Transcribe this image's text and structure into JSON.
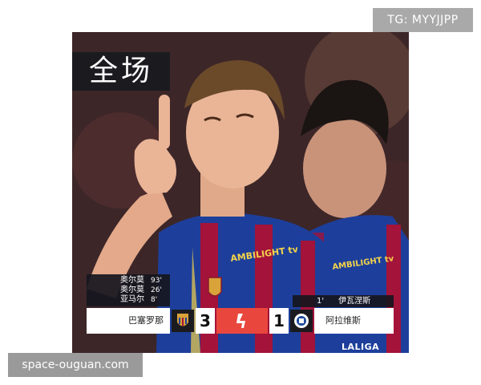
{
  "watermark_top": "TG: MYYJJPP",
  "watermark_bottom": "space-ouguan.com",
  "title": "全场",
  "match": {
    "home_team": "巴塞罗那",
    "away_team": "阿拉维斯",
    "home_score": "3",
    "away_score": "1",
    "home_scorers": [
      {
        "name": "奥尔莫",
        "minute": "93'"
      },
      {
        "name": "奥尔莫",
        "minute": "26'"
      },
      {
        "name": "亚马尔",
        "minute": "8'"
      }
    ],
    "away_scorers": [
      {
        "name": "伊瓦涅斯",
        "minute": "1'"
      }
    ],
    "league": "LALIGA",
    "home_crest_icon": "barcelona-crest-icon",
    "away_crest_icon": "alaves-crest-icon",
    "league_icon": "laliga-logo-icon"
  },
  "sponsor_text": "AMBILIGHT tv",
  "colors": {
    "league_accent": "#e9473d",
    "barca_blue": "#1d3f9b",
    "barca_red": "#a3133a",
    "sponsor_gold": "#f3d24a"
  }
}
